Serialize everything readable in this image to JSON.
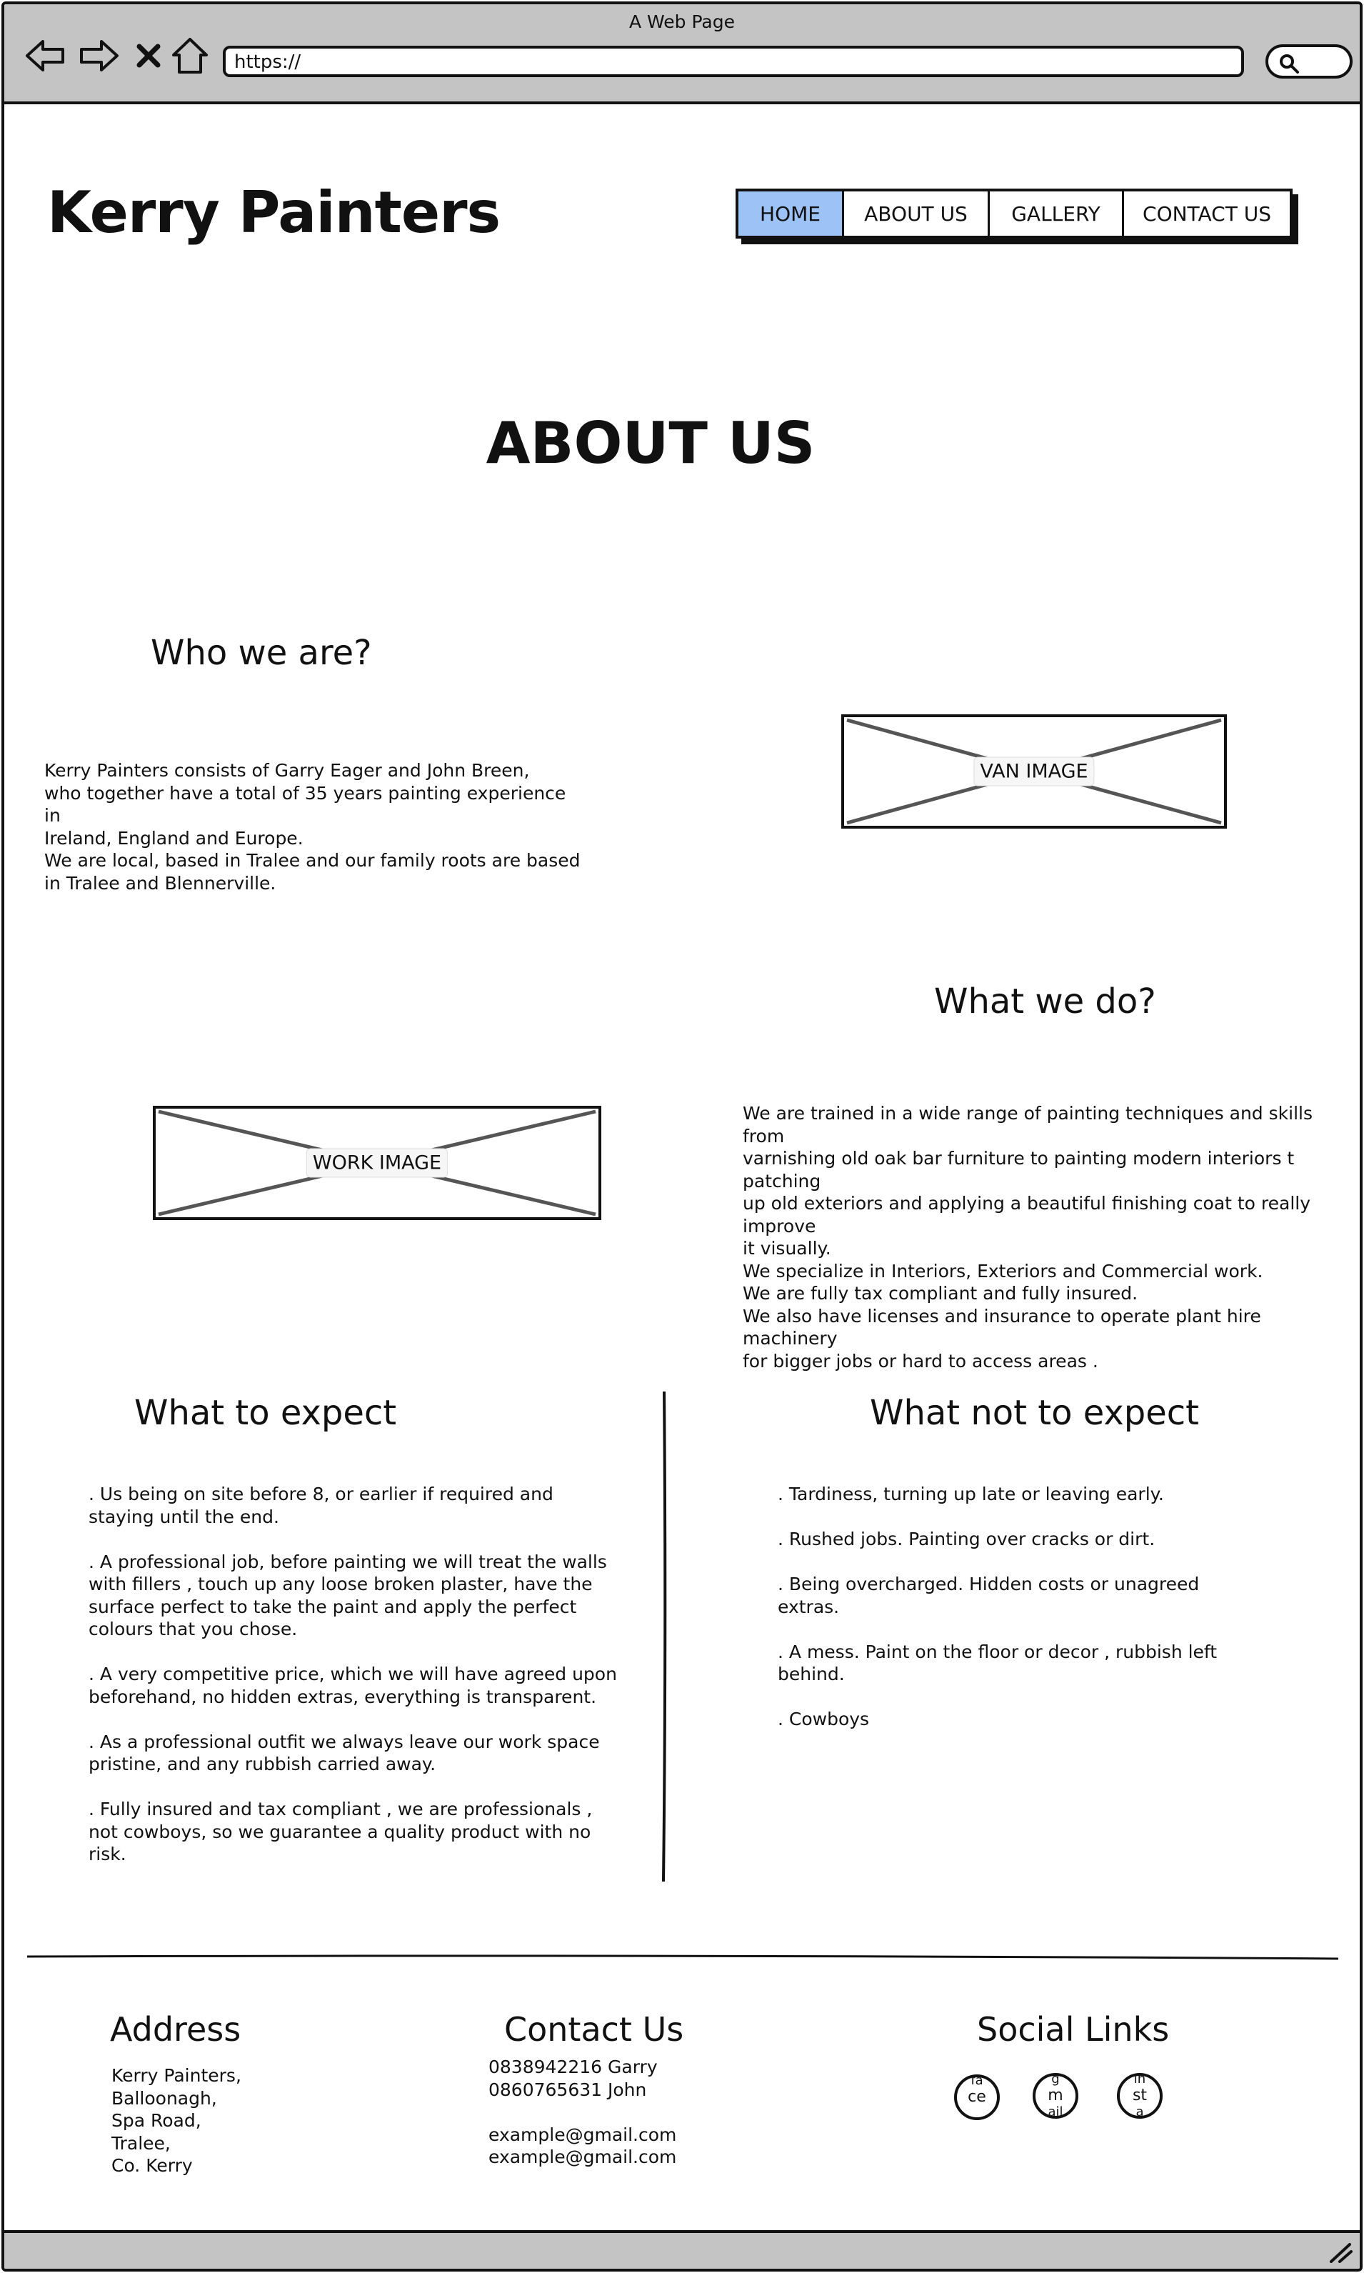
{
  "window": {
    "title": "A Web Page",
    "url": "https://"
  },
  "browser_icons": [
    "back-icon",
    "forward-icon",
    "close-icon",
    "home-icon",
    "search-icon"
  ],
  "header": {
    "site_title": "Kerry Painters",
    "nav": [
      {
        "label": "HOME",
        "active": true
      },
      {
        "label": "ABOUT US",
        "active": false
      },
      {
        "label": "GALLERY",
        "active": false
      },
      {
        "label": "CONTACT US",
        "active": false
      }
    ],
    "active_color": "#9cc2f6"
  },
  "page_heading": "ABOUT US",
  "who": {
    "heading": "Who we are?",
    "lines": [
      "Kerry Painters consists of Garry Eager and John Breen,",
      "who together have a total of 35 years painting experience in",
      "Ireland, England and Europe.",
      "We are local, based in Tralee and our family roots are based",
      "in Tralee and Blennerville."
    ],
    "image_label": "VAN IMAGE"
  },
  "what_we_do": {
    "heading": "What we do?",
    "lines": [
      "We are trained in a wide range of painting techniques and skills from",
      "varnishing old oak bar furniture to painting modern interiors t patching",
      "up old exteriors and applying a beautiful finishing coat to really improve",
      "it visually.",
      "We specialize in Interiors, Exteriors and Commercial work.",
      "We are fully tax compliant and fully insured.",
      "We also have licenses and insurance to operate plant hire machinery",
      "for bigger jobs or hard to access areas ."
    ],
    "image_label": "WORK IMAGE"
  },
  "expect": {
    "heading": "What to expect",
    "items": [
      [
        ". Us being on site before 8, or earlier if required and",
        "staying until the end."
      ],
      [
        ". A professional job, before painting we will treat the walls",
        "with fillers , touch up any loose broken plaster, have the",
        "surface perfect to take the paint and apply the perfect",
        "colours that you chose."
      ],
      [
        ". A very competitive price, which we will have agreed upon",
        "beforehand, no hidden extras, everything is transparent."
      ],
      [
        ". As a professional outfit we always leave our work space",
        "pristine, and any rubbish carried away."
      ],
      [
        ". Fully insured and tax compliant , we are professionals ,",
        "not cowboys, so we guarantee a quality product with no",
        "risk."
      ]
    ]
  },
  "not_expect": {
    "heading": "What not to expect",
    "items": [
      [
        ". Tardiness, turning up late or leaving early."
      ],
      [
        ". Rushed jobs. Painting over cracks or dirt."
      ],
      [
        ". Being overcharged. Hidden costs  or unagreed",
        "extras."
      ],
      [
        ". A mess. Paint on the floor or decor , rubbish left",
        "behind."
      ],
      [
        ". Cowboys"
      ]
    ]
  },
  "footer": {
    "address": {
      "heading": "Address",
      "lines": [
        "Kerry Painters,",
        "Balloonagh,",
        "Spa Road,",
        "Tralee,",
        "Co. Kerry"
      ]
    },
    "contact": {
      "heading": "Contact Us",
      "lines": [
        "0838942216 Garry",
        "0860765631 John",
        "",
        "example@gmail.com",
        "example@gmail.com"
      ]
    },
    "social": {
      "heading": "Social Links",
      "icons": [
        {
          "top": "fa",
          "mid": "ce",
          "bottom": ""
        },
        {
          "top": "g",
          "mid": "m",
          "bottom": "ail"
        },
        {
          "top": "in",
          "mid": "st",
          "bottom": "a"
        }
      ]
    }
  }
}
